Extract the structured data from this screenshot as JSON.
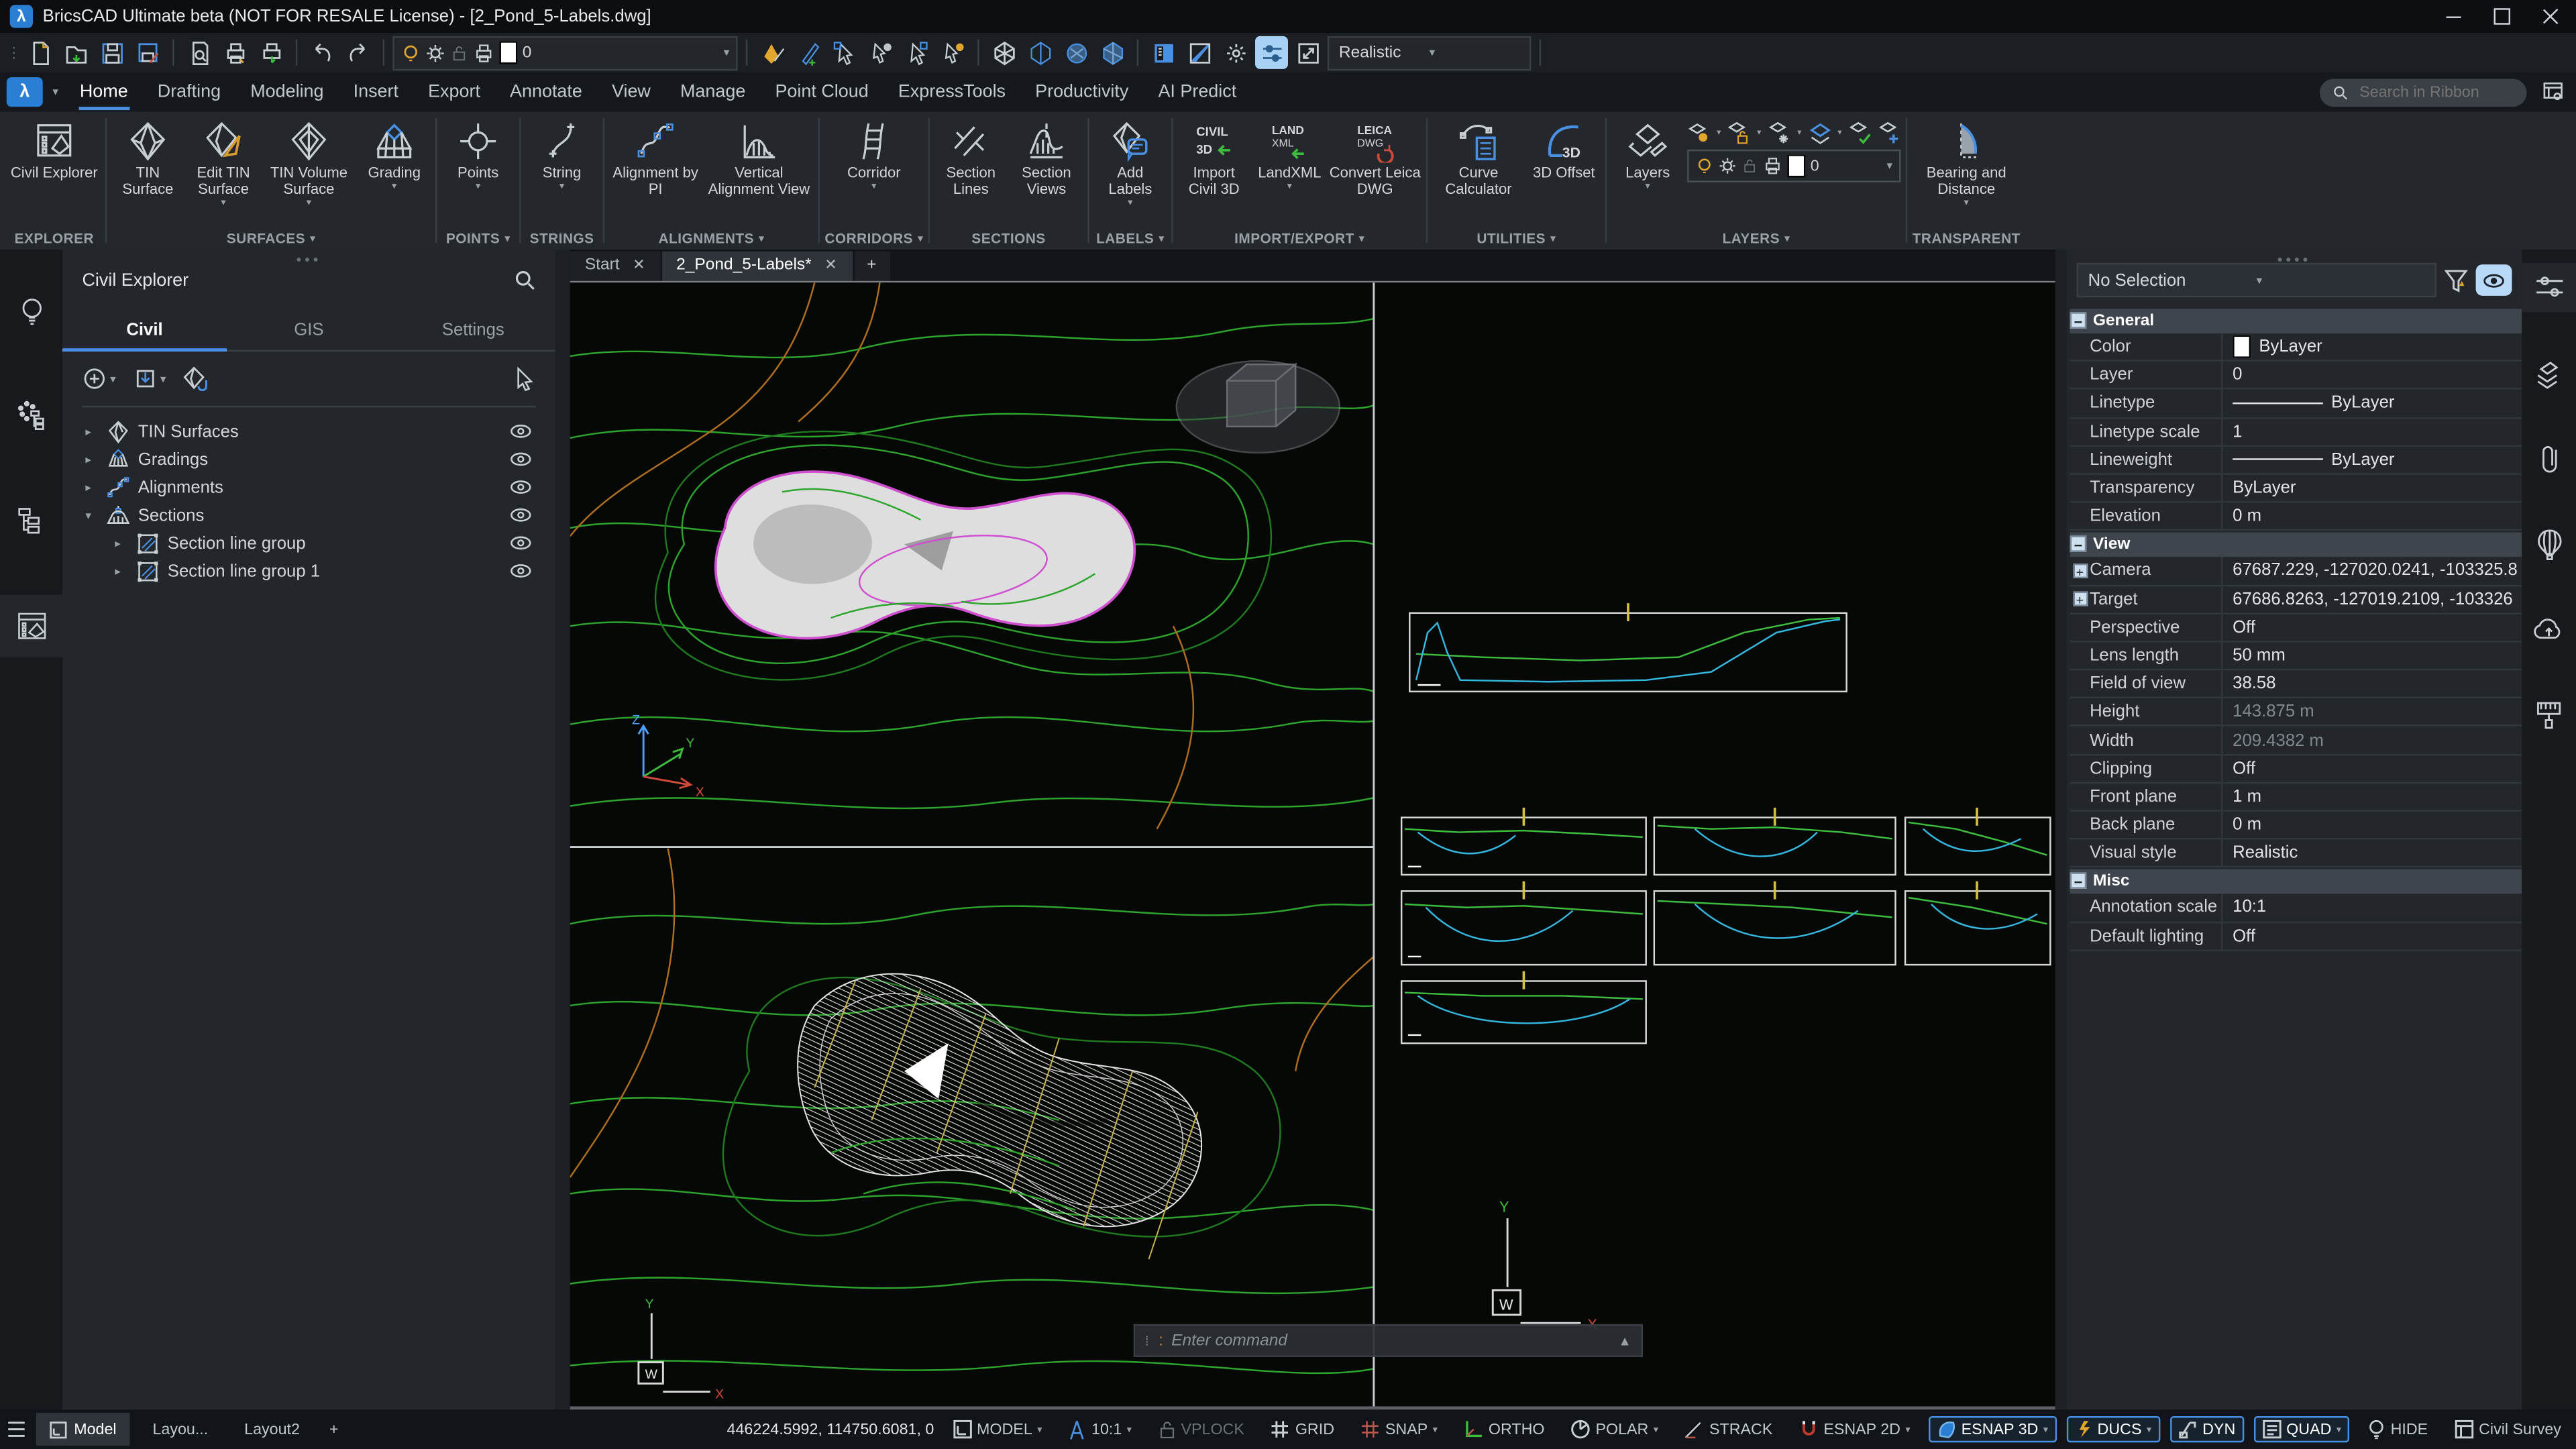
{
  "window": {
    "title": "BricsCAD Ultimate beta (NOT FOR RESALE License) - [2_Pond_5-Labels.dwg]"
  },
  "qat": {
    "layer_value": "0",
    "visual_style": "Realistic"
  },
  "ribbon": {
    "tabs": [
      "Home",
      "Drafting",
      "Modeling",
      "Insert",
      "Export",
      "Annotate",
      "View",
      "Manage",
      "Point Cloud",
      "ExpressTools",
      "Productivity",
      "AI Predict"
    ],
    "active_tab": "Home",
    "search_placeholder": "Search in Ribbon",
    "icon_texts": {
      "civil3d_1": "CIVIL",
      "civil3d_2": "3D",
      "landxml_1": "LAND",
      "landxml_2": "XML",
      "leica_1": "LEICA",
      "leica_2": "DWG",
      "offset3d": "3D"
    },
    "groups": [
      {
        "name": "EXPLORER",
        "buttons": [
          {
            "label": "Civil Explorer"
          }
        ]
      },
      {
        "name": "SURFACES",
        "buttons": [
          {
            "label": "TIN Surface"
          },
          {
            "label": "Edit TIN Surface"
          },
          {
            "label": "TIN Volume Surface"
          },
          {
            "label": "Grading"
          }
        ]
      },
      {
        "name": "POINTS",
        "buttons": [
          {
            "label": "Points"
          }
        ]
      },
      {
        "name": "STRINGS",
        "buttons": [
          {
            "label": "String"
          }
        ]
      },
      {
        "name": "ALIGNMENTS",
        "buttons": [
          {
            "label": "Alignment by PI"
          },
          {
            "label": "Vertical Alignment View"
          }
        ]
      },
      {
        "name": "CORRIDORS",
        "buttons": [
          {
            "label": "Corridor"
          }
        ]
      },
      {
        "name": "SECTIONS",
        "buttons": [
          {
            "label": "Section Lines"
          },
          {
            "label": "Section Views"
          }
        ]
      },
      {
        "name": "LABELS",
        "buttons": [
          {
            "label": "Add Labels"
          }
        ]
      },
      {
        "name": "IMPORT/EXPORT",
        "buttons": [
          {
            "label": "Import Civil 3D"
          },
          {
            "label": "LandXML"
          },
          {
            "label": "Convert Leica DWG"
          }
        ]
      },
      {
        "name": "UTILITIES",
        "buttons": [
          {
            "label": "Curve Calculator"
          },
          {
            "label": "3D Offset"
          }
        ]
      },
      {
        "name": "LAYERS",
        "buttons": [
          {
            "label": "Layers"
          }
        ],
        "layer_value": "0"
      },
      {
        "name": "TRANSPARENT",
        "buttons": [
          {
            "label": "Bearing and Distance"
          }
        ]
      }
    ]
  },
  "explorer": {
    "title": "Civil Explorer",
    "tabs": [
      "Civil",
      "GIS",
      "Settings"
    ],
    "active_tab": "Civil",
    "tree": [
      {
        "label": "TIN Surfaces"
      },
      {
        "label": "Gradings"
      },
      {
        "label": "Alignments"
      },
      {
        "label": "Sections"
      },
      {
        "label": "Section line group"
      },
      {
        "label": "Section line group 1"
      }
    ]
  },
  "doc_tabs": {
    "tabs": [
      "Start",
      "2_Pond_5-Labels*"
    ],
    "active": "2_Pond_5-Labels*"
  },
  "command_line": {
    "prompt": ":",
    "placeholder": "Enter command"
  },
  "props": {
    "selector": "No Selection",
    "sections": [
      {
        "title": "General",
        "rows": [
          {
            "label": "Color",
            "value": "ByLayer"
          },
          {
            "label": "Layer",
            "value": "0"
          },
          {
            "label": "Linetype",
            "value": "ByLayer"
          },
          {
            "label": "Linetype scale",
            "value": "1"
          },
          {
            "label": "Lineweight",
            "value": "ByLayer"
          },
          {
            "label": "Transparency",
            "value": "ByLayer"
          },
          {
            "label": "Elevation",
            "value": "0 m"
          }
        ]
      },
      {
        "title": "View",
        "rows": [
          {
            "label": "Camera",
            "value": "67687.229, -127020.0241, -103325.8"
          },
          {
            "label": "Target",
            "value": "67686.8263, -127019.2109, -103326"
          },
          {
            "label": "Perspective",
            "value": "Off"
          },
          {
            "label": "Lens length",
            "value": "50 mm"
          },
          {
            "label": "Field of view",
            "value": "38.58"
          },
          {
            "label": "Height",
            "value": "143.875 m"
          },
          {
            "label": "Width",
            "value": "209.4382 m"
          },
          {
            "label": "Clipping",
            "value": "Off"
          },
          {
            "label": "Front plane",
            "value": "1 m"
          },
          {
            "label": "Back plane",
            "value": "0 m"
          },
          {
            "label": "Visual style",
            "value": "Realistic"
          }
        ]
      },
      {
        "title": "Misc",
        "rows": [
          {
            "label": "Annotation scale",
            "value": "10:1"
          },
          {
            "label": "Default lighting",
            "value": "Off"
          }
        ]
      }
    ]
  },
  "status": {
    "layout_tabs": [
      "Model",
      "Layou...",
      "Layout2"
    ],
    "coords": "446224.5992, 114750.6081, 0",
    "model": "MODEL",
    "scale": "10:1",
    "vplock": "VPLOCK",
    "toggles": [
      {
        "label": "GRID"
      },
      {
        "label": "SNAP"
      },
      {
        "label": "ORTHO"
      },
      {
        "label": "POLAR"
      },
      {
        "label": "STRACK"
      },
      {
        "label": "ESNAP 2D"
      },
      {
        "label": "ESNAP 3D"
      },
      {
        "label": "DUCS"
      },
      {
        "label": "DYN"
      },
      {
        "label": "QUAD"
      },
      {
        "label": "HIDE"
      },
      {
        "label": "Civil Survey"
      }
    ]
  },
  "colors": {
    "accent": "#4a90e2",
    "contour_green": "#2da52d",
    "contour_orange": "#b06f1f",
    "pond_outline": "#cf4fd0",
    "section_cyan": "#35b8e0",
    "section_green": "#3dbc3d",
    "tick_yellow": "#d4c23a"
  }
}
